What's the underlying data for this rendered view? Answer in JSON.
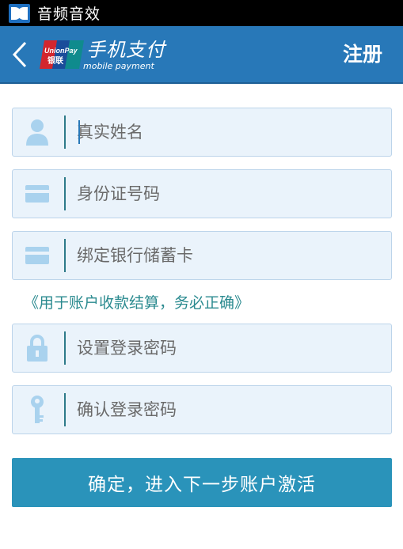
{
  "status_bar": {
    "app_title": "音频音效"
  },
  "header": {
    "logo_text": "UnionPay 银联",
    "brand_cn": "手机支付",
    "brand_en": "mobile payment",
    "title": "注册"
  },
  "form": {
    "name": {
      "placeholder": "真实姓名",
      "value": ""
    },
    "id_number": {
      "placeholder": "身份证号码",
      "value": ""
    },
    "bank_card": {
      "placeholder": "绑定银行储蓄卡",
      "value": ""
    },
    "notice": "《用于账户收款结算，务必正确》",
    "login_password": {
      "placeholder": "设置登录密码",
      "value": ""
    },
    "confirm_password": {
      "placeholder": "确认登录密码",
      "value": ""
    }
  },
  "submit_label": "确定，进入下一步账户激活",
  "colors": {
    "header": "#2878b8",
    "field_bg": "#eaf3fb",
    "icon": "#a9d2ee",
    "button": "#2a93ba",
    "notice": "#2a8a8f"
  }
}
